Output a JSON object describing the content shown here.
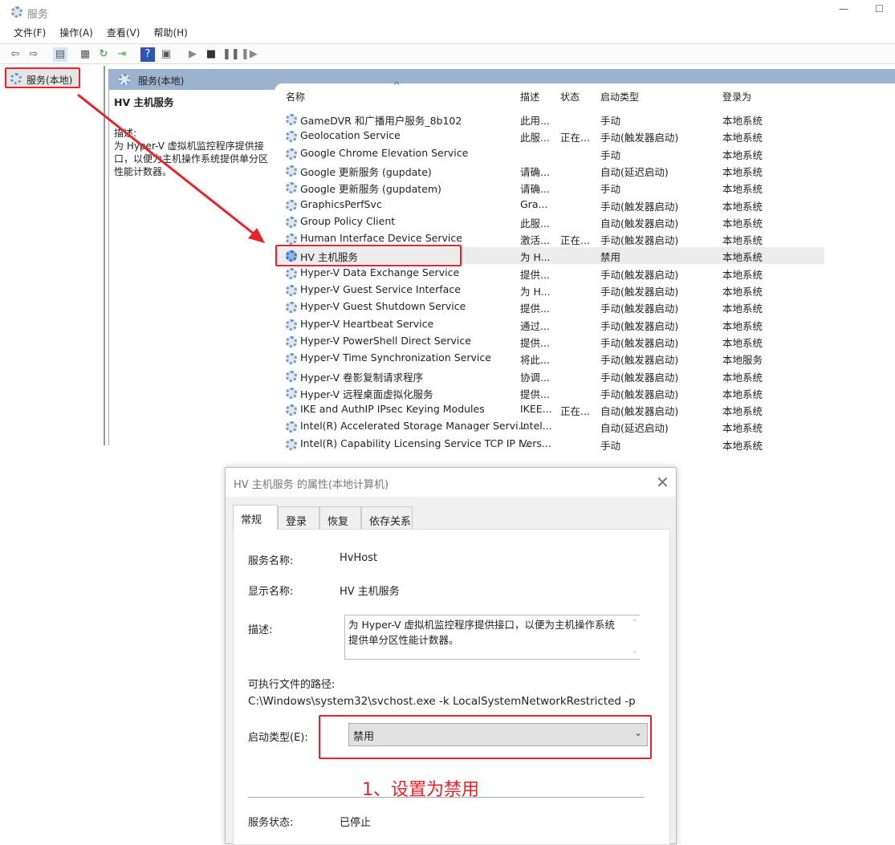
{
  "window": {
    "title": "服务",
    "icon": "gear-icon"
  },
  "menu": [
    "文件(F)",
    "操作(A)",
    "查看(V)",
    "帮助(H)"
  ],
  "toolbar": [
    "back-icon",
    "forward-icon",
    "show-hide-tree-icon",
    "properties-icon",
    "refresh-icon",
    "export-icon",
    "help-icon",
    "console-icon",
    "start-icon",
    "stop-icon",
    "pause-icon",
    "resume-icon"
  ],
  "tree": {
    "item": "服务(本地)"
  },
  "pane": {
    "header": "服务(本地)",
    "selected_title": "HV 主机服务",
    "desc_label": "描述:",
    "desc_text": "为 Hyper-V 虚拟机监控程序提供接口，以便为主机操作系统提供单分区性能计数器。"
  },
  "columns": [
    "名称",
    "描述",
    "状态",
    "启动类型",
    "登录为"
  ],
  "sort_indicator": "^",
  "rows": [
    [
      "GameDVR 和广播用户服务_8b102",
      "此用...",
      "",
      "手动",
      "本地系统"
    ],
    [
      "Geolocation Service",
      "此服...",
      "正在...",
      "手动(触发器启动)",
      "本地系统"
    ],
    [
      "Google Chrome Elevation Service",
      "",
      "",
      "手动",
      "本地系统"
    ],
    [
      "Google 更新服务 (gupdate)",
      "请确...",
      "",
      "自动(延迟启动)",
      "本地系统"
    ],
    [
      "Google 更新服务 (gupdatem)",
      "请确...",
      "",
      "手动",
      "本地系统"
    ],
    [
      "GraphicsPerfSvc",
      "Gra...",
      "",
      "手动(触发器启动)",
      "本地系统"
    ],
    [
      "Group Policy Client",
      "此服...",
      "",
      "自动(触发器启动)",
      "本地系统"
    ],
    [
      "Human Interface Device Service",
      "激活...",
      "正在...",
      "手动(触发器启动)",
      "本地系统"
    ],
    [
      "HV 主机服务",
      "为 H...",
      "",
      "禁用",
      "本地系统"
    ],
    [
      "Hyper-V Data Exchange Service",
      "提供...",
      "",
      "手动(触发器启动)",
      "本地系统"
    ],
    [
      "Hyper-V Guest Service Interface",
      "为 H...",
      "",
      "手动(触发器启动)",
      "本地系统"
    ],
    [
      "Hyper-V Guest Shutdown Service",
      "提供...",
      "",
      "手动(触发器启动)",
      "本地系统"
    ],
    [
      "Hyper-V Heartbeat Service",
      "通过...",
      "",
      "手动(触发器启动)",
      "本地系统"
    ],
    [
      "Hyper-V PowerShell Direct Service",
      "提供...",
      "",
      "手动(触发器启动)",
      "本地系统"
    ],
    [
      "Hyper-V Time Synchronization Service",
      "将此...",
      "",
      "手动(触发器启动)",
      "本地服务"
    ],
    [
      "Hyper-V 卷影复制请求程序",
      "协调...",
      "",
      "手动(触发器启动)",
      "本地系统"
    ],
    [
      "Hyper-V 远程桌面虚拟化服务",
      "提供...",
      "",
      "手动(触发器启动)",
      "本地系统"
    ],
    [
      "IKE and AuthIP IPsec Keying Modules",
      "IKEE...",
      "正在...",
      "自动(触发器启动)",
      "本地系统"
    ],
    [
      "Intel(R) Accelerated Storage Manager Servi...",
      "Intel...",
      "",
      "自动(延迟启动)",
      "本地系统"
    ],
    [
      "Intel(R) Capability Licensing Service TCP IP I...",
      "Vers...",
      "",
      "手动",
      "本地系统"
    ]
  ],
  "selected_row": 8,
  "dialog": {
    "title": "HV 主机服务 的属性(本地计算机)",
    "tabs": [
      "常规",
      "登录",
      "恢复",
      "依存关系"
    ],
    "service_name_label": "服务名称:",
    "service_name": "HvHost",
    "display_name_label": "显示名称:",
    "display_name": "HV 主机服务",
    "desc_label": "描述:",
    "desc": "为 Hyper-V 虚拟机监控程序提供接口，以便为主机操作系统提供单分区性能计数器。",
    "path_label": "可执行文件的路径:",
    "path": "C:\\Windows\\system32\\svchost.exe -k LocalSystemNetworkRestricted -p",
    "startup_label": "启动类型(E):",
    "startup_value": "禁用",
    "status_label": "服务状态:",
    "status_value": "已停止"
  },
  "annotation": {
    "text": "1、设置为禁用",
    "color": "#e8232a"
  }
}
